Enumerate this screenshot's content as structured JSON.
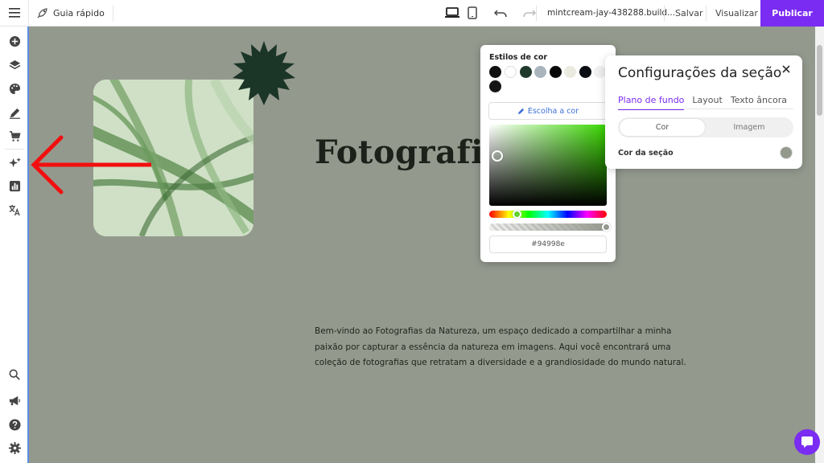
{
  "topbar": {
    "guide_label": "Guia rápido",
    "site_name": "mintcream-jay-438288.build...",
    "save_label": "Salvar",
    "preview_label": "Visualizar",
    "publish_label": "Publicar"
  },
  "canvas": {
    "headline": "Fotografia",
    "paragraph": "Bem-vindo ao Fotografias da Natureza, um espaço dedicado a compartilhar a minha paixão por capturar a essência da natureza em imagens. Aqui você encontrará uma coleção de fotografias que retratam a diversidade e a grandiosidade do mundo natural."
  },
  "color_picker": {
    "title": "Estilos de cor",
    "pick_button_label": "Escolha a cor",
    "hex_value": "#94998e",
    "swatches": [
      "#111111",
      "#ffffff",
      "#1f3a2b",
      "#a9b4bd",
      "#080808",
      "#ebeae0",
      "#0a0d12",
      "#efefef",
      "#141414"
    ]
  },
  "section_settings": {
    "title": "Configurações da seção",
    "tabs": [
      "Plano de fundo",
      "Layout",
      "Texto âncora"
    ],
    "toggle": [
      "Cor",
      "Imagem"
    ],
    "color_label": "Cor da seção",
    "color_value": "#94998e"
  },
  "colors": {
    "accent": "#7a2cf2",
    "background": "#94998e"
  }
}
